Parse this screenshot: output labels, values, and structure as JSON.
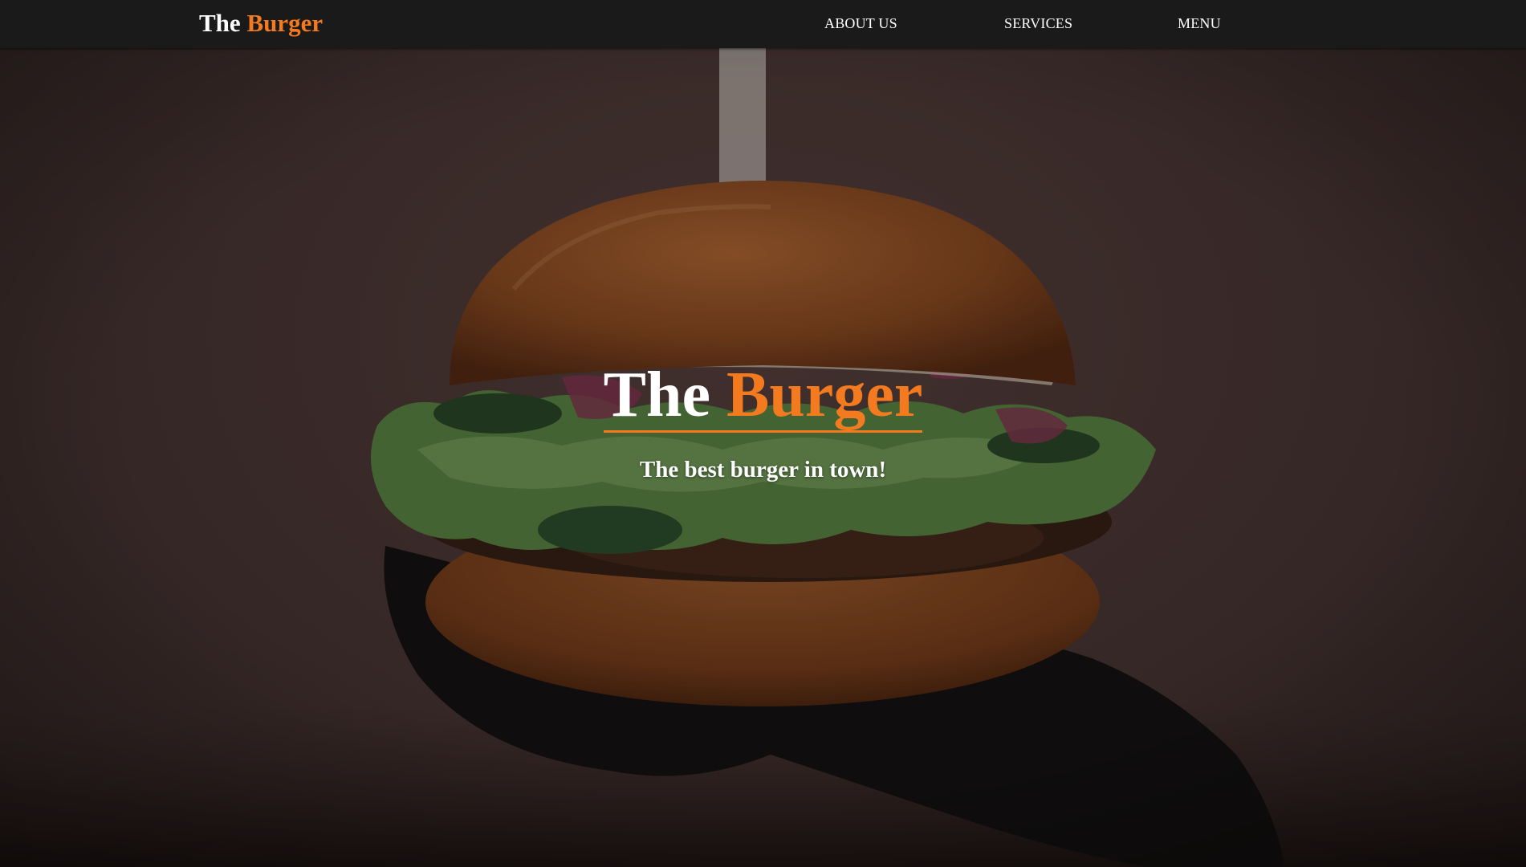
{
  "nav": {
    "brand_first": "The",
    "brand_second": "Burger",
    "links": [
      {
        "label": "ABOUT US"
      },
      {
        "label": "SERVICES"
      },
      {
        "label": "MENU"
      }
    ]
  },
  "hero": {
    "title_first": "The",
    "title_second": "Burger",
    "tagline": "The best burger in town!"
  },
  "colors": {
    "accent": "#f37a1f",
    "navbar_bg": "#1a1a1a",
    "text": "#ffffff"
  },
  "icons": {
    "hero_image": "burger-photo"
  }
}
